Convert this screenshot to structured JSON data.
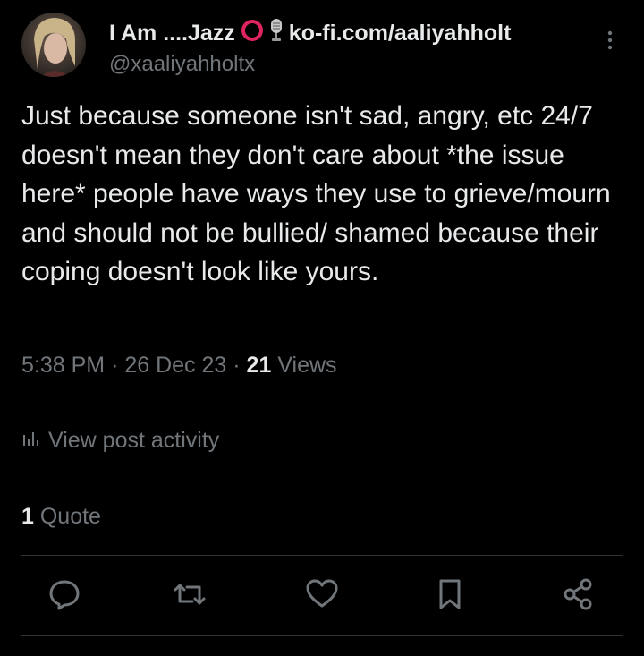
{
  "author": {
    "display_name": "I Am ....Jazz",
    "name_suffix": "ko-fi.com/aaliyahholt",
    "handle": "@xaaliyahholtx",
    "avatar_icon": "profile-photo",
    "emoji": [
      "red-circle-icon",
      "microphone-icon"
    ]
  },
  "tweet": {
    "text": "Just because someone isn't sad, angry, etc 24/7 doesn't mean they don't care about *the issue here* people have ways they use to grieve/mourn and should not be bullied/ shamed because their coping doesn't look like yours.",
    "time": "5:38 PM",
    "sep1": "·",
    "date": "26 Dec 23",
    "sep2": "·",
    "views_count": "21",
    "views_label": "Views"
  },
  "activity_label": "View post activity",
  "quotes": {
    "count": "1",
    "label": "Quote"
  },
  "actions": [
    "reply-icon",
    "retweet-icon",
    "like-icon",
    "bookmark-icon",
    "share-icon"
  ],
  "colors": {
    "background": "#000000",
    "text": "#e7e9ea",
    "secondary": "#71767b",
    "divider": "#2f3336",
    "accent_red": "#e0245e"
  }
}
